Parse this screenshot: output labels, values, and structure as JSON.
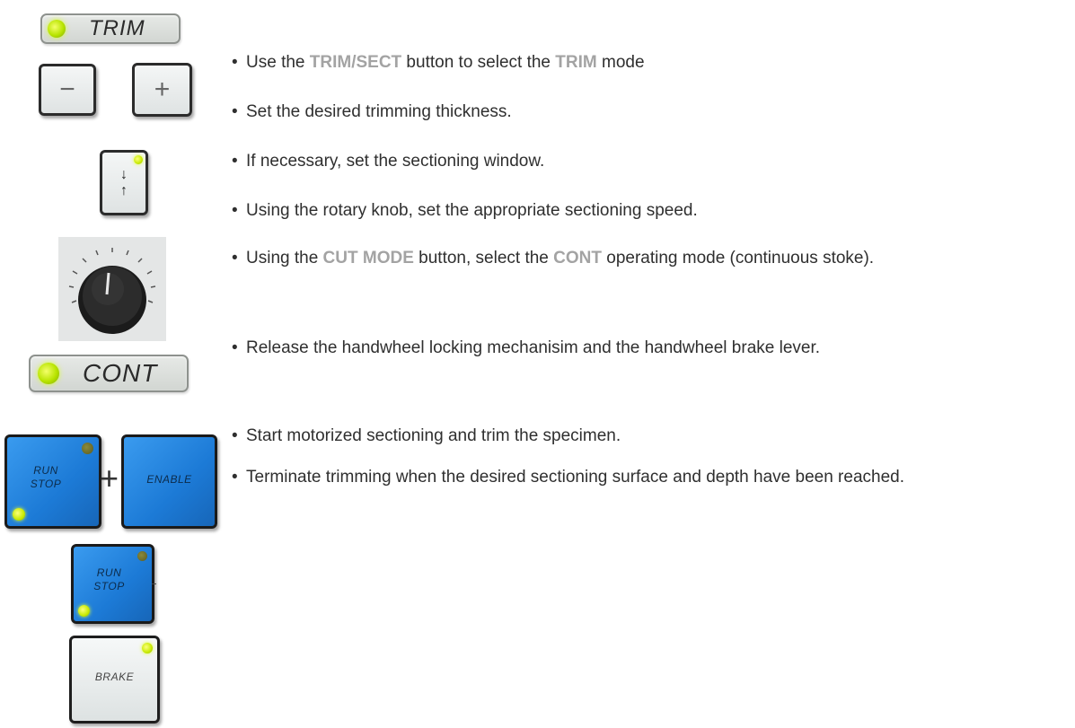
{
  "icons": {
    "trim_indicator": "TRIM",
    "minus_key": "−",
    "plus_key": "+",
    "window_key_arrows": [
      "↓",
      "↑"
    ],
    "cont_indicator": "CONT",
    "run_stop_key": [
      "RUN",
      "STOP"
    ],
    "plus_sign": "+",
    "enable_key": "ENABLE",
    "brake_key": "BRAKE",
    "led_color": "#c7ea00",
    "key_blue_color": "#1c7ad6"
  },
  "steps": [
    {
      "t1": "Use the ",
      "k1": "TRIM/SECT",
      "t2": " button to select the ",
      "k2": "TRIM",
      "t3": " mode"
    },
    {
      "t1": "Set the desired trimming  thickness."
    },
    {
      "t1": "If necessary, set the sectioning window."
    },
    {
      "t1": "Using the rotary knob, set the appropriate sectioning speed."
    },
    {
      "t1": "Using the ",
      "k1": "CUT MODE",
      "t2": " button, select the ",
      "k2": "CONT",
      "t3": " operating mode (continuous stoke)."
    },
    {
      "t1": "Release the handwheel locking mechanisim and the handwheel brake lever."
    },
    {
      "t1": "Start motorized sectioning and trim the specimen."
    },
    {
      "t1": "Terminate trimming when the desired sectioning surface and depth have been reached."
    }
  ]
}
